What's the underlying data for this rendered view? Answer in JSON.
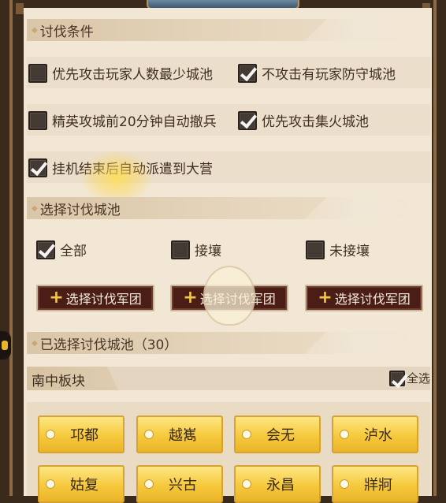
{
  "sections": {
    "conditions": "讨伐条件",
    "select_cities": "选择讨伐城池",
    "selected_cities": "已选择讨伐城池（30）"
  },
  "conditions": [
    {
      "label": "优先攻击玩家人数最少城池",
      "checked": false
    },
    {
      "label": "不攻击有玩家防守城池",
      "checked": true
    },
    {
      "label": "精英攻城前20分钟自动撤兵",
      "checked": false
    },
    {
      "label": "优先攻击集火城池",
      "checked": true
    },
    {
      "label": "挂机结束后自动派遣到大营",
      "checked": true
    }
  ],
  "filters": [
    {
      "label": "全部",
      "checked": true
    },
    {
      "label": "接壤",
      "checked": false
    },
    {
      "label": "未接壤",
      "checked": false
    }
  ],
  "army_buttons": [
    "选择讨伐军团",
    "选择讨伐军团",
    "选择讨伐军团"
  ],
  "region": {
    "name": "南中板块",
    "select_all_label": "全选",
    "select_all_checked": true
  },
  "cities": [
    "邛都",
    "越嶲",
    "会无",
    "泸水",
    "姑复",
    "兴古",
    "永昌",
    "牂牁"
  ],
  "colors": {
    "accent_gold": "#f6c93d",
    "button_dark": "#4a1e17",
    "panel_bg": "#f2e7d4"
  }
}
